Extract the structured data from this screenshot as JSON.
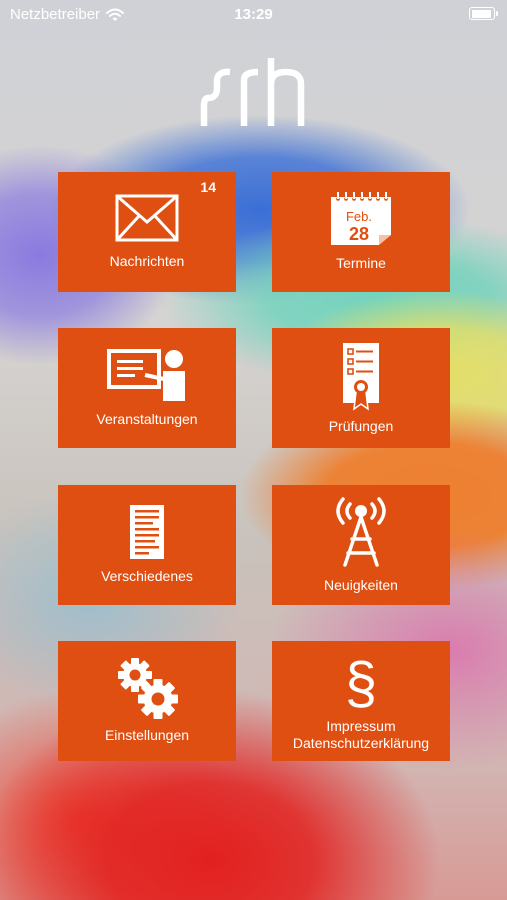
{
  "status_bar": {
    "carrier": "Netzbetreiber",
    "time": "13:29",
    "battery_level": 0.92
  },
  "logo": {
    "alt": "srh"
  },
  "colors": {
    "tile": "#df4f12",
    "text": "#ffffff"
  },
  "tiles": [
    {
      "label": "Nachrichten",
      "icon": "envelope-icon",
      "badge": "14"
    },
    {
      "label": "Termine",
      "icon": "calendar-icon",
      "calendar_month": "Feb.",
      "calendar_day": "28"
    },
    {
      "label": "Veranstaltungen",
      "icon": "presentation-icon"
    },
    {
      "label": "Prüfungen",
      "icon": "certificate-icon"
    },
    {
      "label": "Verschiedenes",
      "icon": "document-icon"
    },
    {
      "label": "Neuigkeiten",
      "icon": "antenna-icon"
    },
    {
      "label": "Einstellungen",
      "icon": "gears-icon"
    },
    {
      "label_line1": "Impressum",
      "label_line2": "Datenschutzerklärung",
      "icon": "paragraph-icon"
    }
  ]
}
